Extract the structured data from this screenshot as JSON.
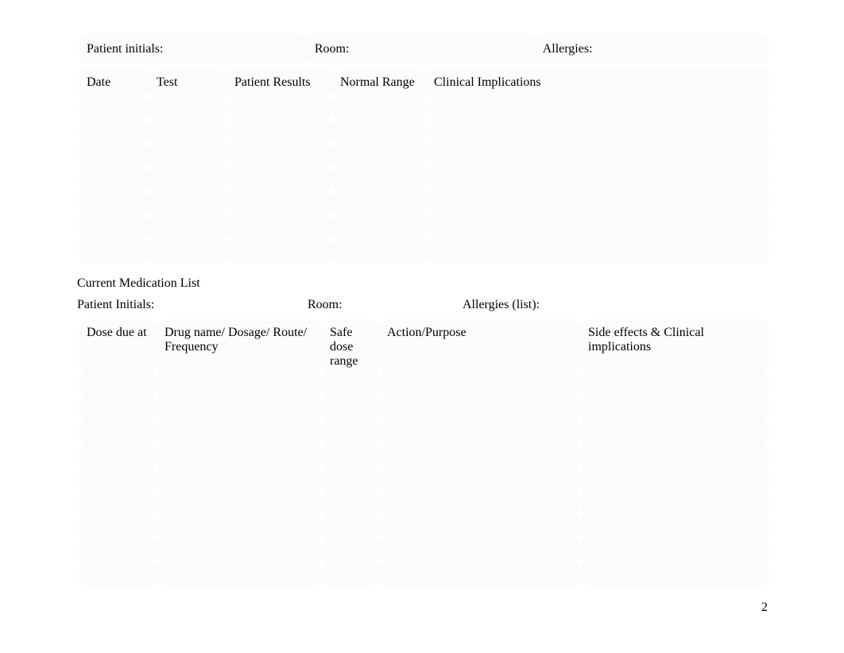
{
  "patient_info": {
    "initials_label": "Patient initials:",
    "room_label": "Room:",
    "allergies_label": "Allergies:"
  },
  "labs_table": {
    "headers": [
      "Date",
      "Test",
      "Patient Results",
      "Normal Range",
      "Clinical Implications"
    ],
    "row_count": 7
  },
  "meds_section": {
    "title": "Current Medication List",
    "pi": {
      "initials_label": "Patient Initials:",
      "room_label": "Room:",
      "allergies_label": "Allergies (list):"
    },
    "headers": [
      "Dose due at",
      "Drug name/ Dosage/ Route/ Frequency",
      "Safe dose range",
      "Action/Purpose",
      "Side effects & Clinical implications"
    ],
    "row_count": 9
  },
  "page_number": "2"
}
